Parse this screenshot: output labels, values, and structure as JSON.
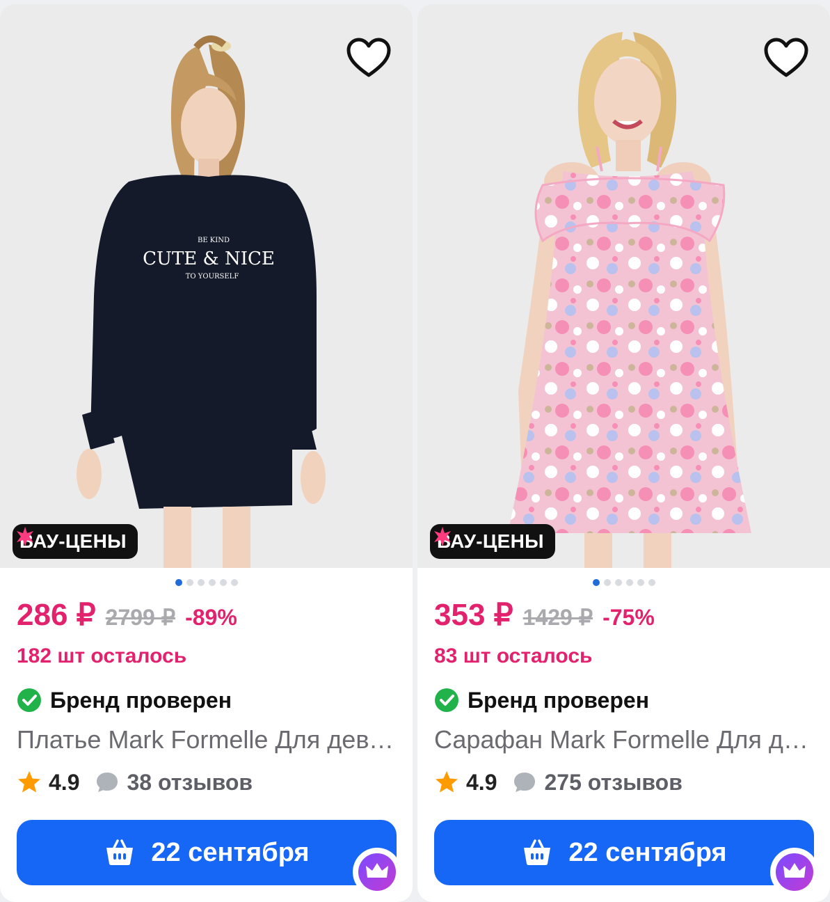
{
  "products": [
    {
      "badge": "ВАУ-ЦЕНЫ",
      "price": "286 ₽",
      "old_price": "2799 ₽",
      "discount": "-89%",
      "stock": "182 шт осталось",
      "brand_status": "Бренд проверен",
      "title": "Платье Mark Formelle Для девочек",
      "rating": "4.9",
      "reviews": "38 отзывов",
      "delivery": "22 сентября",
      "print_lines": [
        "BE KIND",
        "CUTE & NICE",
        "TO YOURSELF"
      ],
      "photo_slides": 6,
      "active_slide": 1
    },
    {
      "badge": "ВАУ-ЦЕНЫ",
      "price": "353 ₽",
      "old_price": "1429 ₽",
      "discount": "-75%",
      "stock": "83 шт осталось",
      "brand_status": "Бренд проверен",
      "title": "Сарафан Mark Formelle Для девочек",
      "rating": "4.9",
      "reviews": "275 отзывов",
      "delivery": "22 сентября",
      "photo_slides": 6,
      "active_slide": 1
    }
  ],
  "colors": {
    "accent_pink": "#e3226e",
    "button_blue": "#1767f6",
    "verified_green": "#21b24a",
    "star_orange": "#ff9a00"
  },
  "icons": [
    "heart-icon",
    "sparkle-icon",
    "check-circle-icon",
    "star-icon",
    "comment-icon",
    "basket-icon",
    "crown-icon"
  ]
}
